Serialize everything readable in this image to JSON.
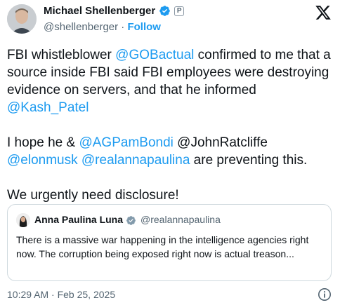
{
  "header": {
    "display_name": "Michael Shellenberger",
    "verified_icon": "verified-badge-icon",
    "affiliation_badge": "P",
    "handle": "@shellenberger",
    "separator": "·",
    "follow_label": "Follow",
    "logo_icon": "x-logo-icon"
  },
  "body": {
    "para1": {
      "t1": "FBI whistleblower ",
      "m1": "@GOBactual",
      "t2": " confirmed to me that a source inside FBI said FBI employees were destroying evidence on servers, and that he informed  ",
      "m2": "@Kash_Patel"
    },
    "para2": {
      "t1": "I hope he & ",
      "m1": "@AGPamBondi",
      "t2": " @JohnRatcliffe ",
      "m2": "@elonmusk",
      "t3": " ",
      "m3": "@realannapaulina",
      "t4": " are preventing this."
    },
    "para3": "We urgently need disclosure!"
  },
  "quote": {
    "display_name": "Anna Paulina Luna",
    "verified_icon": "verified-badge-icon",
    "handle": "@realannapaulina",
    "text": "There is a massive war happening in the intelligence agencies right now. The corruption being exposed right now is actual treason..."
  },
  "footer": {
    "timestamp": "10:29 AM · Feb 25, 2025",
    "info_icon": "info-icon"
  },
  "colors": {
    "link": "#1d9bf0",
    "text": "#0f1419",
    "secondary": "#536471",
    "border": "#cfd9de"
  }
}
